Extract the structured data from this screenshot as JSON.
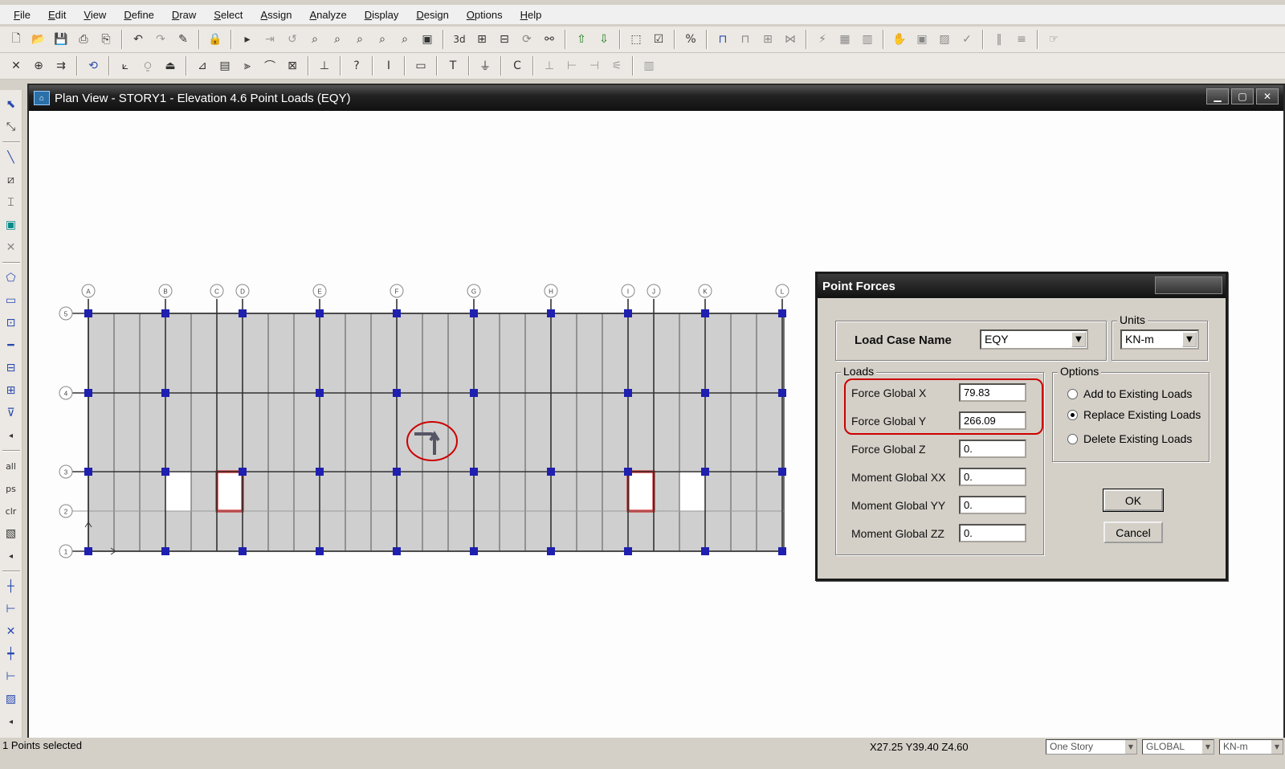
{
  "menu": [
    "File",
    "Edit",
    "View",
    "Define",
    "Draw",
    "Select",
    "Assign",
    "Analyze",
    "Display",
    "Design",
    "Options",
    "Help"
  ],
  "toolbar1_icons": [
    "new-icon",
    "open-icon",
    "save-icon",
    "print-icon",
    "print-preview-icon",
    "undo-icon",
    "redo-icon",
    "pencil-icon",
    "lock-icon",
    "run-icon",
    "rubber-band-zoom-icon",
    "restore-icon",
    "zoom-window-icon",
    "zoom-in-icon",
    "zoom-out-icon",
    "pan-icon",
    "zoom-full-icon",
    "3d-view-icon",
    "plan-view-icon",
    "elevation-view-icon",
    "rotate-icon",
    "perspective-icon",
    "move-up-icon",
    "move-down-icon",
    "object-shrink-icon",
    "set-display-icon",
    "percent-icon"
  ],
  "toolbar2_icons": [
    "reshape-icon",
    "snap-icon",
    "replicate-icon",
    "refresh-icon",
    "frame-icon",
    "joint-icon",
    "area-icon",
    "wall-icon",
    "load-icon",
    "help-icon",
    "section-icon",
    "slab-icon",
    "beam-icon",
    "column-icon",
    "deck-icon"
  ],
  "lefttoolbar_icons": [
    "pointer-icon",
    "reshape-tool-icon",
    "draw-line-icon",
    "draw-brace-icon",
    "draw-column-icon",
    "draw-area-icon",
    "draw-wall-icon",
    "draw-opening-icon",
    "draw-poly-icon",
    "draw-rect-icon",
    "draw-point-icon",
    "draw-dim-icon",
    "draw-grid-icon",
    "draw-section-icon",
    "select-all-icon",
    "select-previous-icon",
    "clear-selection-icon",
    "intersect-icon",
    "snap-point-icon",
    "snap-end-icon",
    "snap-intersect-icon",
    "snap-perp-icon",
    "snap-line-icon",
    "snap-grid-icon"
  ],
  "plan_window": {
    "title": "Plan View - STORY1 - Elevation 4.6  Point Loads (EQY)",
    "grid_x_labels": [
      "A",
      "B",
      "C",
      "D",
      "E",
      "F",
      "G",
      "H",
      "I",
      "J",
      "K",
      "L"
    ],
    "grid_y_labels": [
      "5",
      "4",
      "3",
      "2",
      "1"
    ]
  },
  "dialog": {
    "title": "Point Forces",
    "load_case_label": "Load Case Name",
    "load_case_value": "EQY",
    "units_legend": "Units",
    "units_value": "KN-m",
    "loads_legend": "Loads",
    "loads": [
      {
        "label": "Force Global X",
        "value": "79.83"
      },
      {
        "label": "Force Global Y",
        "value": "266.09"
      },
      {
        "label": "Force Global Z",
        "value": "0."
      },
      {
        "label": "Moment Global XX",
        "value": "0."
      },
      {
        "label": "Moment Global YY",
        "value": "0."
      },
      {
        "label": "Moment Global ZZ",
        "value": "0."
      }
    ],
    "options_legend": "Options",
    "options": [
      {
        "label": "Add to Existing Loads",
        "checked": false
      },
      {
        "label": "Replace Existing Loads",
        "checked": true
      },
      {
        "label": "Delete Existing Loads",
        "checked": false
      }
    ],
    "ok_label": "OK",
    "cancel_label": "Cancel"
  },
  "status": {
    "selection": "1 Points selected",
    "coords": "X27.25  Y39.40  Z4.60",
    "story_mode": "One Story",
    "coord_system": "GLOBAL",
    "units": "KN-m"
  },
  "colors": {
    "slab_fill": "#cfcfcf",
    "joint": "#1f1fb0",
    "highlight": "#cc0000",
    "title_bar": "#1a1a1a"
  }
}
